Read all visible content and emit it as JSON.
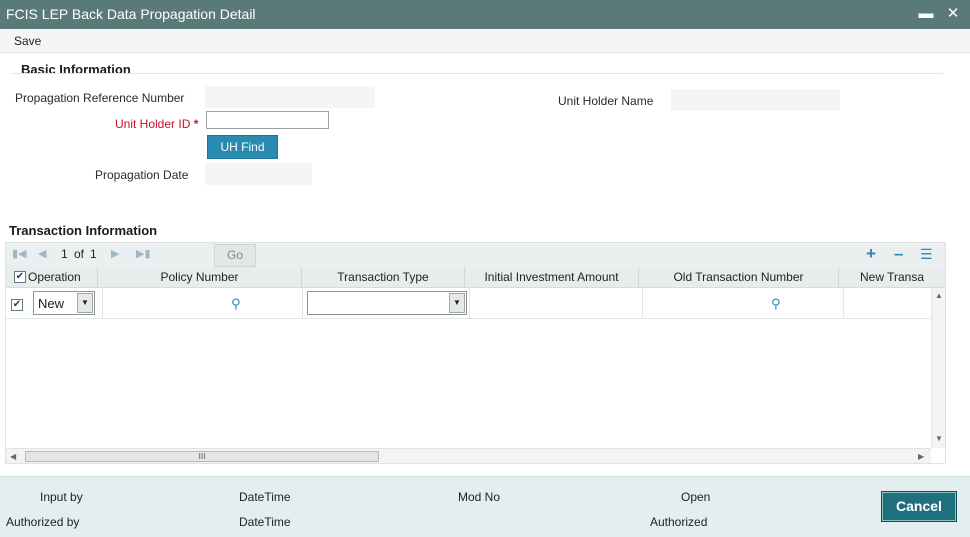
{
  "window": {
    "title": "FCIS LEP Back Data Propagation Detail",
    "minimize_glyph": "▬",
    "close_glyph": "✕"
  },
  "menubar": {
    "save_label": "Save"
  },
  "basic_info": {
    "heading": "Basic Information",
    "propagation_ref_label": "Propagation Reference Number",
    "propagation_ref_value": "",
    "unit_holder_name_label": "Unit Holder Name",
    "unit_holder_name_value": "",
    "unit_holder_id_label": "Unit Holder ID",
    "required_marker": "*",
    "unit_holder_id_value": "",
    "uh_find_label": "UH Find",
    "propagation_date_label": "Propagation Date",
    "propagation_date_value": ""
  },
  "transaction_info": {
    "heading": "Transaction Information",
    "pager": {
      "current": "1",
      "of_label": "of",
      "total": "1",
      "go_label": "Go"
    },
    "columns": [
      "Operation",
      "Policy Number",
      "Transaction Type",
      "Initial Investment Amount",
      "Old Transaction Number",
      "New Transa"
    ],
    "rows": [
      {
        "checked": true,
        "operation": "New",
        "policy_number": "",
        "transaction_type": "",
        "initial_investment_amount": "",
        "old_transaction_number": "",
        "new_transaction_number": ""
      }
    ],
    "hscroll_thumb_glyph": "III"
  },
  "footer": {
    "input_by_label": "Input by",
    "authorized_by_label": "Authorized by",
    "datetime_label_1": "DateTime",
    "datetime_label_2": "DateTime",
    "mod_no_label": "Mod No",
    "open_label": "Open",
    "authorized_label": "Authorized",
    "cancel_label": "Cancel"
  },
  "colors": {
    "titlebar": "#5a7a7a",
    "accent": "#2a8bb0",
    "required": "#c8102e",
    "cancel_button": "#1f6f7d",
    "footer_bg": "#e3eeee"
  },
  "icons": {
    "minimize": "minimize-icon",
    "close": "close-icon",
    "first_page": "first-page-icon",
    "prev_page": "previous-page-icon",
    "next_page": "next-page-icon",
    "last_page": "last-page-icon",
    "add_row": "add-row-icon",
    "delete_row": "delete-row-icon",
    "view_list": "list-view-icon",
    "lookup": "search-icon"
  }
}
